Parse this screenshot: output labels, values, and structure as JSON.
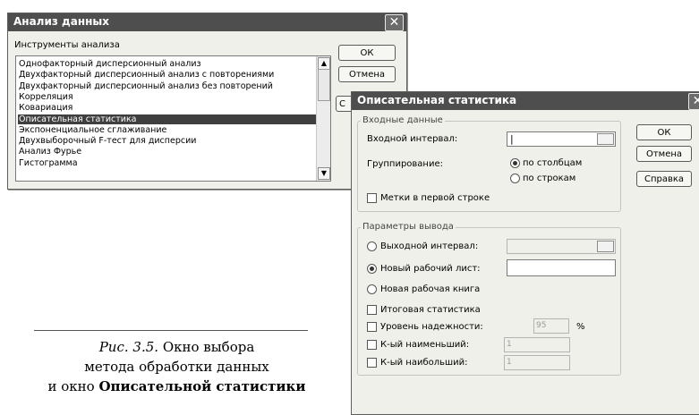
{
  "win1": {
    "title": "Анализ данных",
    "tools_label": "Инструменты анализа",
    "items": [
      "Однофакторный дисперсионный анализ",
      "Двухфакторный дисперсионный анализ с повторениями",
      "Двухфакторный дисперсионный анализ без повторений",
      "Корреляция",
      "Ковариация",
      "Описательная статистика",
      "Экспоненциальное сглаживание",
      "Двухвыборочный F-тест для дисперсии",
      "Анализ Фурье",
      "Гистограмма"
    ],
    "selected_item": "Описательная статистика",
    "ok_label": "ОК",
    "cancel_label": "Отмена",
    "help_partial": "С"
  },
  "win2": {
    "title": "Описательная статистика",
    "input_group": "Входные данные",
    "input_range_label": "Входной интервал:",
    "input_range_value": "|",
    "grouping_label": "Группирование:",
    "by_columns": "по столбцам",
    "by_rows": "по строкам",
    "labels_first_row": "Метки в первой строке",
    "output_group": "Параметры вывода",
    "output_range_label": "Выходной интервал:",
    "new_sheet_label": "Новый рабочий лист:",
    "new_book_label": "Новая рабочая книга",
    "summary_stats": "Итоговая статистика",
    "confidence_level": "Уровень надежности:",
    "confidence_value": "95",
    "percent_sign": "%",
    "kth_smallest": "К-ый наименьший:",
    "kth_smallest_value": "1",
    "kth_largest": "К-ый наибольший:",
    "kth_largest_value": "1",
    "ok_label": "ОК",
    "cancel_label": "Отмена",
    "help_label": "Справка"
  },
  "caption": {
    "prefix": "Рис. 3.5.",
    "line1": " Окно выбора",
    "line2": "метода обработки данных",
    "line3_start": "и окно ",
    "line3_bold": "Описательной статистики"
  }
}
